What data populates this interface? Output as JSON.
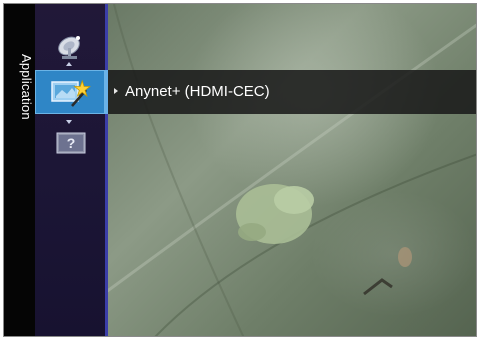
{
  "sidebar": {
    "section_label": "Application"
  },
  "menu": {
    "selected_item_label": "Anynet+ (HDMI-CEC)"
  },
  "icons": {
    "top": "satellite-dish-icon",
    "selected": "magic-wand-screen-icon",
    "bottom": "help-question-icon"
  },
  "colors": {
    "highlight": "#2f86c6",
    "sidebar_bg": "#050505",
    "icon_column_bg": "#1c1636",
    "menu_bar_bg": "#181818"
  }
}
